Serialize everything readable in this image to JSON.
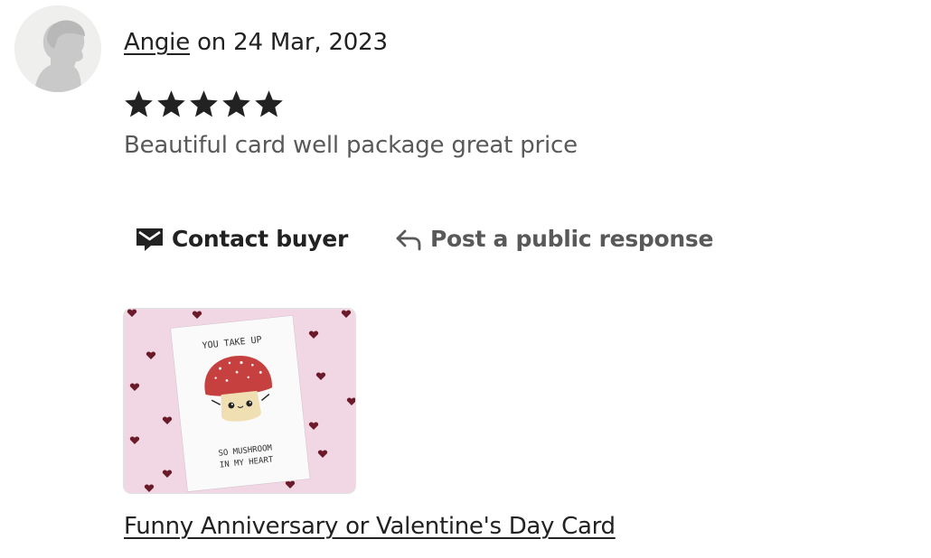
{
  "review": {
    "reviewer_name": "Angie",
    "date_text": " on 24 Mar, 2023",
    "rating": 5,
    "max_rating": 5,
    "text": "Beautiful card well package great price"
  },
  "actions": {
    "contact_buyer": "Contact buyer",
    "post_response": "Post a public response"
  },
  "listing": {
    "title": "Funny Anniversary or Valentine's Day Card",
    "card_text_top": "YOU TAKE UP",
    "card_text_bottom_1": "SO MUSHROOM",
    "card_text_bottom_2": "IN MY HEART"
  },
  "icons": {
    "avatar": "default-avatar-icon",
    "star": "star-icon",
    "contact": "envelope-icon",
    "reply": "reply-arrow-icon"
  },
  "colors": {
    "text_primary": "#222222",
    "text_secondary": "#595959",
    "star": "#222222",
    "card_background": "#f1d7e3",
    "mushroom_cap": "#c6403f"
  }
}
